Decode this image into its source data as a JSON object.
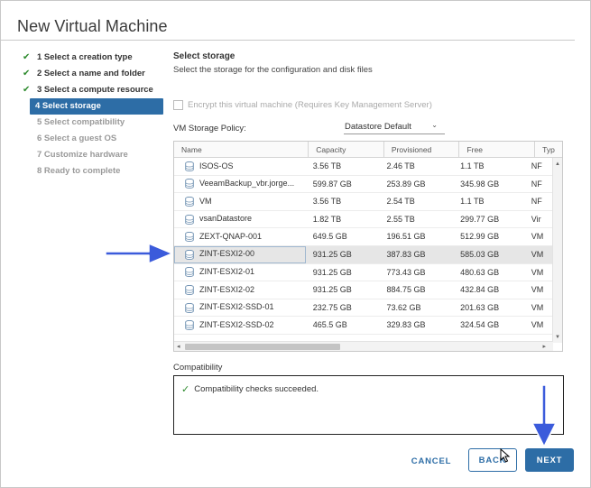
{
  "dialog": {
    "title": "New Virtual Machine"
  },
  "steps": [
    {
      "label": "1 Select a creation type",
      "state": "done"
    },
    {
      "label": "2 Select a name and folder",
      "state": "done"
    },
    {
      "label": "3 Select a compute resource",
      "state": "done"
    },
    {
      "label": "4 Select storage",
      "state": "active"
    },
    {
      "label": "5 Select compatibility",
      "state": "future"
    },
    {
      "label": "6 Select a guest OS",
      "state": "future"
    },
    {
      "label": "7 Customize hardware",
      "state": "future"
    },
    {
      "label": "8 Ready to complete",
      "state": "future"
    }
  ],
  "main": {
    "section_title": "Select storage",
    "section_desc": "Select the storage for the configuration and disk files",
    "encrypt_label": "Encrypt this virtual machine (Requires Key Management Server)",
    "policy_label": "VM Storage Policy:",
    "policy_value": "Datastore Default"
  },
  "table": {
    "columns": [
      "Name",
      "Capacity",
      "Provisioned",
      "Free",
      "Typ"
    ],
    "rows": [
      {
        "name": "ISOS-OS",
        "capacity": "3.56 TB",
        "provisioned": "2.46 TB",
        "free": "1.1 TB",
        "type": "NF"
      },
      {
        "name": "VeeamBackup_vbr.jorge...",
        "capacity": "599.87 GB",
        "provisioned": "253.89 GB",
        "free": "345.98 GB",
        "type": "NF"
      },
      {
        "name": "VM",
        "capacity": "3.56 TB",
        "provisioned": "2.54 TB",
        "free": "1.1 TB",
        "type": "NF"
      },
      {
        "name": "vsanDatastore",
        "capacity": "1.82 TB",
        "provisioned": "2.55 TB",
        "free": "299.77 GB",
        "type": "Vir"
      },
      {
        "name": "ZEXT-QNAP-001",
        "capacity": "649.5 GB",
        "provisioned": "196.51 GB",
        "free": "512.99 GB",
        "type": "VM"
      },
      {
        "name": "ZINT-ESXI2-00",
        "capacity": "931.25 GB",
        "provisioned": "387.83 GB",
        "free": "585.03 GB",
        "type": "VM",
        "selected": true
      },
      {
        "name": "ZINT-ESXI2-01",
        "capacity": "931.25 GB",
        "provisioned": "773.43 GB",
        "free": "480.63 GB",
        "type": "VM"
      },
      {
        "name": "ZINT-ESXI2-02",
        "capacity": "931.25 GB",
        "provisioned": "884.75 GB",
        "free": "432.84 GB",
        "type": "VM"
      },
      {
        "name": "ZINT-ESXI2-SSD-01",
        "capacity": "232.75 GB",
        "provisioned": "73.62 GB",
        "free": "201.63 GB",
        "type": "VM"
      },
      {
        "name": "ZINT-ESXI2-SSD-02",
        "capacity": "465.5 GB",
        "provisioned": "329.83 GB",
        "free": "324.54 GB",
        "type": "VM"
      }
    ]
  },
  "compatibility": {
    "label": "Compatibility",
    "message": "Compatibility checks succeeded."
  },
  "footer": {
    "cancel_label": "CANCEL",
    "back_label": "BACK",
    "next_label": "NEXT"
  },
  "colors": {
    "accent": "#2d6da6",
    "annotation_arrow": "#3b5bdb",
    "success": "#2e8b2e"
  }
}
